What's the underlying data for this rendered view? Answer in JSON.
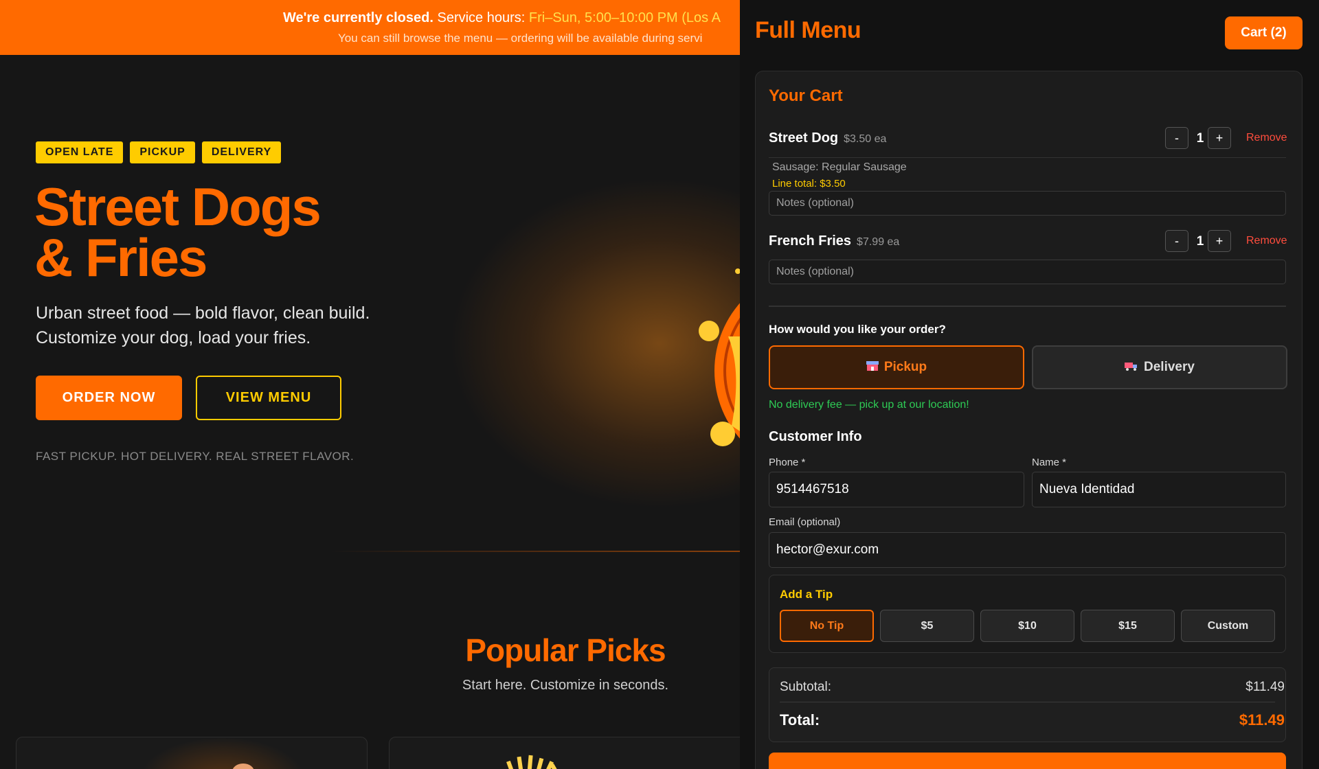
{
  "banner": {
    "closed": "We're currently closed.",
    "hours_label": "Service hours:",
    "hours_value": "Fri–Sun, 5:00–10:00 PM",
    "tz": "(Los A",
    "line2": "You can still browse the menu — ordering will be available during servi"
  },
  "hero": {
    "badges": [
      "OPEN LATE",
      "PICKUP",
      "DELIVERY"
    ],
    "title_line1": "Street Dogs",
    "title_line2": "& Fries",
    "subtitle": "Urban street food — bold flavor, clean build. Customize your dog, load your fries.",
    "order_btn": "ORDER NOW",
    "view_btn": "VIEW MENU",
    "tagline": "FAST PICKUP. HOT DELIVERY. REAL STREET FLAVOR."
  },
  "popular": {
    "title": "Popular Picks",
    "subtitle": "Start here. Customize in seconds."
  },
  "panel": {
    "title": "Full Menu",
    "cart_btn": "Cart (2)",
    "cart_heading": "Your Cart",
    "items": [
      {
        "name": "Street Dog",
        "price": "$3.50 ea",
        "qty": "1",
        "remove": "Remove",
        "meta": "Sausage: Regular Sausage",
        "line_total": "Line total: $3.50",
        "notes_placeholder": "Notes (optional)"
      },
      {
        "name": "French Fries",
        "price": "$7.99 ea",
        "qty": "1",
        "remove": "Remove",
        "notes_placeholder": "Notes (optional)"
      }
    ],
    "qty_minus": "-",
    "qty_plus": "+",
    "order_question": "How would you like your order?",
    "pickup_label": "Pickup",
    "delivery_label": "Delivery",
    "no_fee": "No delivery fee — pick up at our location!",
    "customer_heading": "Customer Info",
    "phone_label": "Phone *",
    "phone_value": "9514467518",
    "name_label": "Name *",
    "name_value": "Nueva Identidad",
    "email_label": "Email (optional)",
    "email_value": "hector@exur.com",
    "tip_heading": "Add a Tip",
    "tips": [
      "No Tip",
      "$5",
      "$10",
      "$15",
      "Custom"
    ],
    "subtotal_label": "Subtotal:",
    "subtotal_value": "$11.49",
    "total_label": "Total:",
    "total_value": "$11.49"
  },
  "colors": {
    "accent": "#ff6a00",
    "highlight": "#ffcc00",
    "success": "#2ecc55",
    "danger": "#ff4d3d"
  },
  "icons": {
    "pickup": "store-icon",
    "delivery": "truck-icon"
  }
}
